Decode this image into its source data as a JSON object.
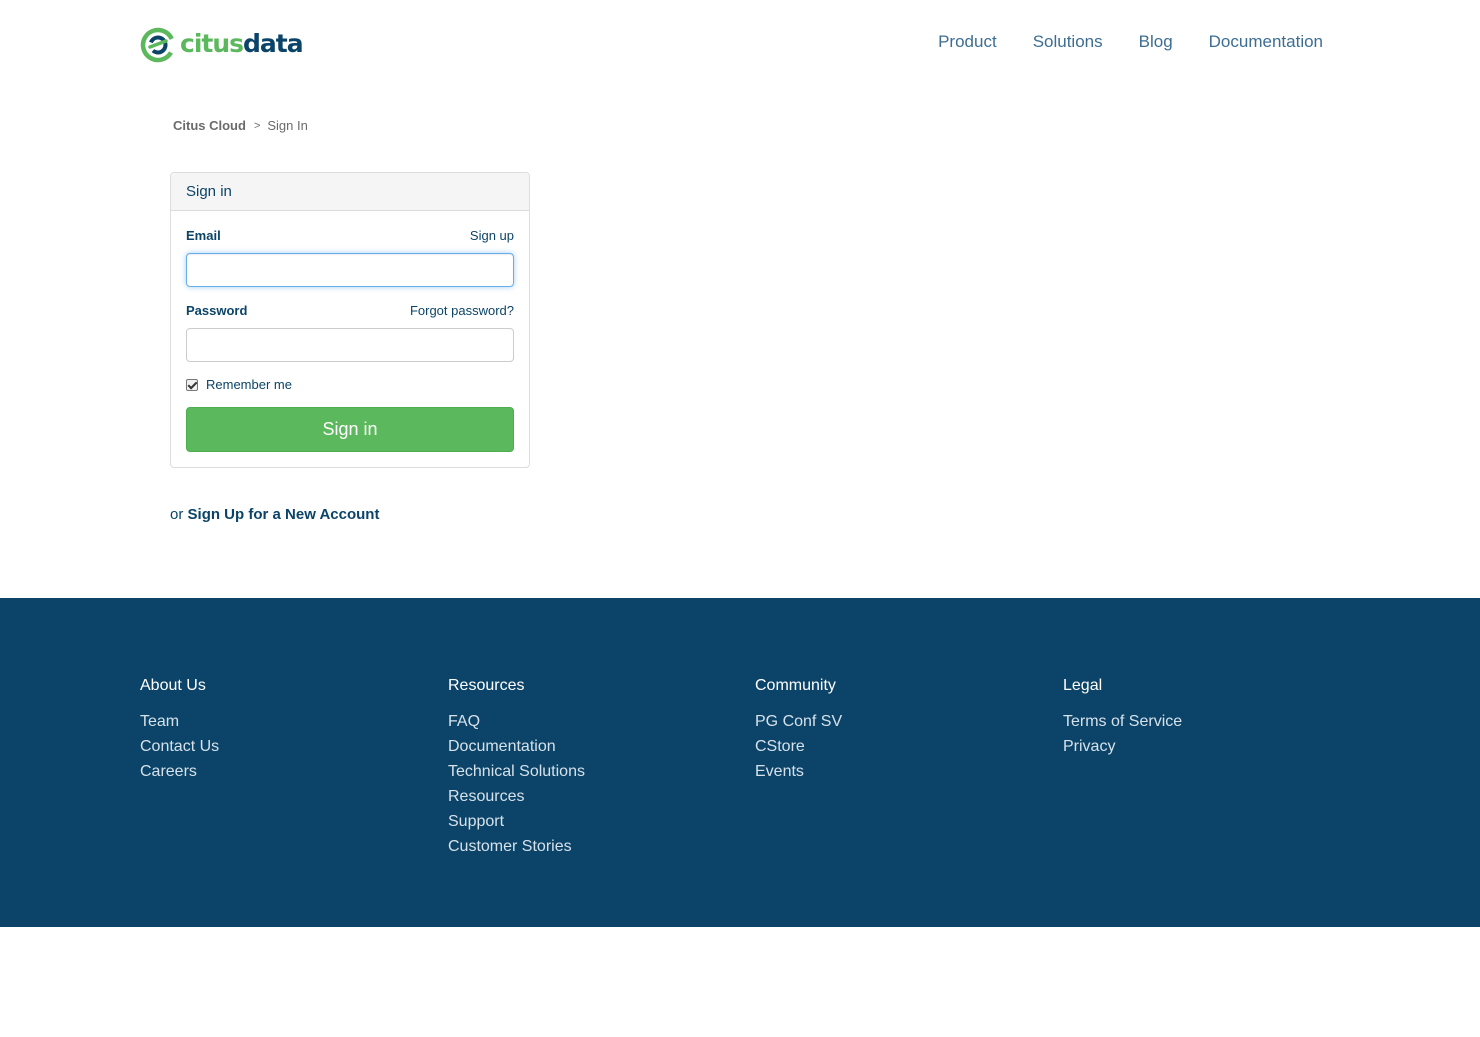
{
  "header": {
    "logo": {
      "part1": "citus",
      "part2": "data"
    },
    "nav": [
      "Product",
      "Solutions",
      "Blog",
      "Documentation"
    ]
  },
  "breadcrumb": {
    "root": "Citus Cloud",
    "separator": ">",
    "current": "Sign In"
  },
  "signin_panel": {
    "title": "Sign in",
    "email_label": "Email",
    "signup_link": "Sign up",
    "email_value": "",
    "password_label": "Password",
    "forgot_link": "Forgot password?",
    "password_value": "",
    "remember_label": "Remember me",
    "remember_checked": true,
    "submit_label": "Sign in"
  },
  "signup_prompt": {
    "prefix": "or",
    "link": "Sign Up for a New Account"
  },
  "footer": {
    "columns": [
      {
        "heading": "About Us",
        "links": [
          "Team",
          "Contact Us",
          "Careers"
        ]
      },
      {
        "heading": "Resources",
        "links": [
          "FAQ",
          "Documentation",
          "Technical Solutions",
          "Resources",
          "Support",
          "Customer Stories"
        ]
      },
      {
        "heading": "Community",
        "links": [
          "PG Conf SV",
          "CStore",
          "Events"
        ]
      },
      {
        "heading": "Legal",
        "links": [
          "Terms of Service",
          "Privacy"
        ]
      }
    ]
  },
  "colors": {
    "brand_green": "#5cb85c",
    "brand_navy": "#0b4468",
    "footer_bg": "#0b4468"
  }
}
